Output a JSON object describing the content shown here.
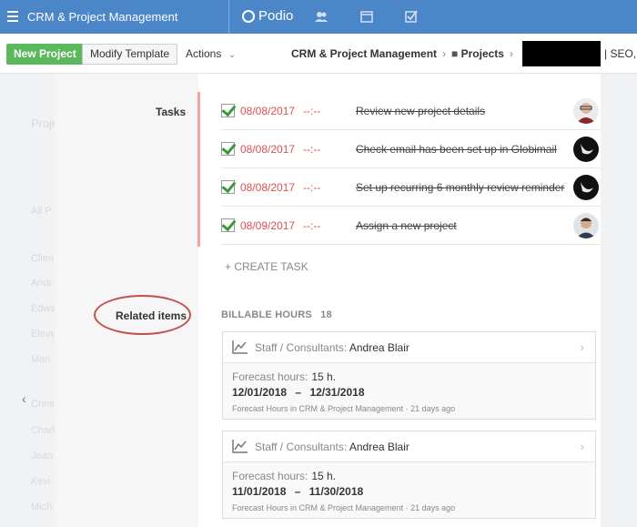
{
  "topbar": {
    "app_title": "CRM & Project Management",
    "logo": "Podio",
    "icons": [
      "menu-icon",
      "contacts-icon",
      "calendar-icon",
      "tasks-icon"
    ]
  },
  "toolbar": {
    "new_label": "New Project",
    "modify_label": "Modify Template",
    "actions_label": "Actions",
    "crumb_workspace": "CRM & Project Management",
    "crumb_app": "Projects",
    "crumb_tail": "| SEO,"
  },
  "left_ghost": [
    "Proje",
    "All P",
    "Clien",
    "Andr",
    "Edwa",
    "Eleve",
    "Man",
    "Chris",
    "Charl",
    "Jean",
    "Kevi",
    "Mich"
  ],
  "sections": {
    "tasks_label": "Tasks",
    "related_label": "Related items"
  },
  "tasks": [
    {
      "date": "08/08/2017",
      "time": "--:--",
      "title": "Review new project details",
      "avatar": "man-glasses"
    },
    {
      "date": "08/08/2017",
      "time": "--:--",
      "title": "Check email has been set up in Globimail",
      "avatar": "dark-profile"
    },
    {
      "date": "08/08/2017",
      "time": "--:--",
      "title": "Set up recurring 6 monthly review reminder",
      "avatar": "dark-profile"
    },
    {
      "date": "08/09/2017",
      "time": "--:--",
      "title": "Assign a new project",
      "avatar": "man-beard"
    }
  ],
  "create_task": "+ CREATE TASK",
  "billable": {
    "label": "BILLABLE HOURS",
    "count": "18"
  },
  "cards": [
    {
      "title_prefix": "Staff / Consultants:",
      "name": "Andrea Blair",
      "hours_label": "Forecast hours:",
      "hours_value": "15 h.",
      "date_from": "12/01/2018",
      "dash": "–",
      "date_to": "12/31/2018",
      "meta": "Forecast Hours in CRM & Project Management · 21 days ago"
    },
    {
      "title_prefix": "Staff / Consultants:",
      "name": "Andrea Blair",
      "hours_label": "Forecast hours:",
      "hours_value": "15 h.",
      "date_from": "11/01/2018",
      "dash": "–",
      "date_to": "11/30/2018",
      "meta": "Forecast Hours in CRM & Project Management · 21 days ago"
    }
  ],
  "colors": {
    "topbar": "#4a86c8",
    "new_button": "#5cb85c",
    "due_red": "#d9534f",
    "check_green": "#3a9a3a",
    "highlight_oval": "#c0504d"
  }
}
